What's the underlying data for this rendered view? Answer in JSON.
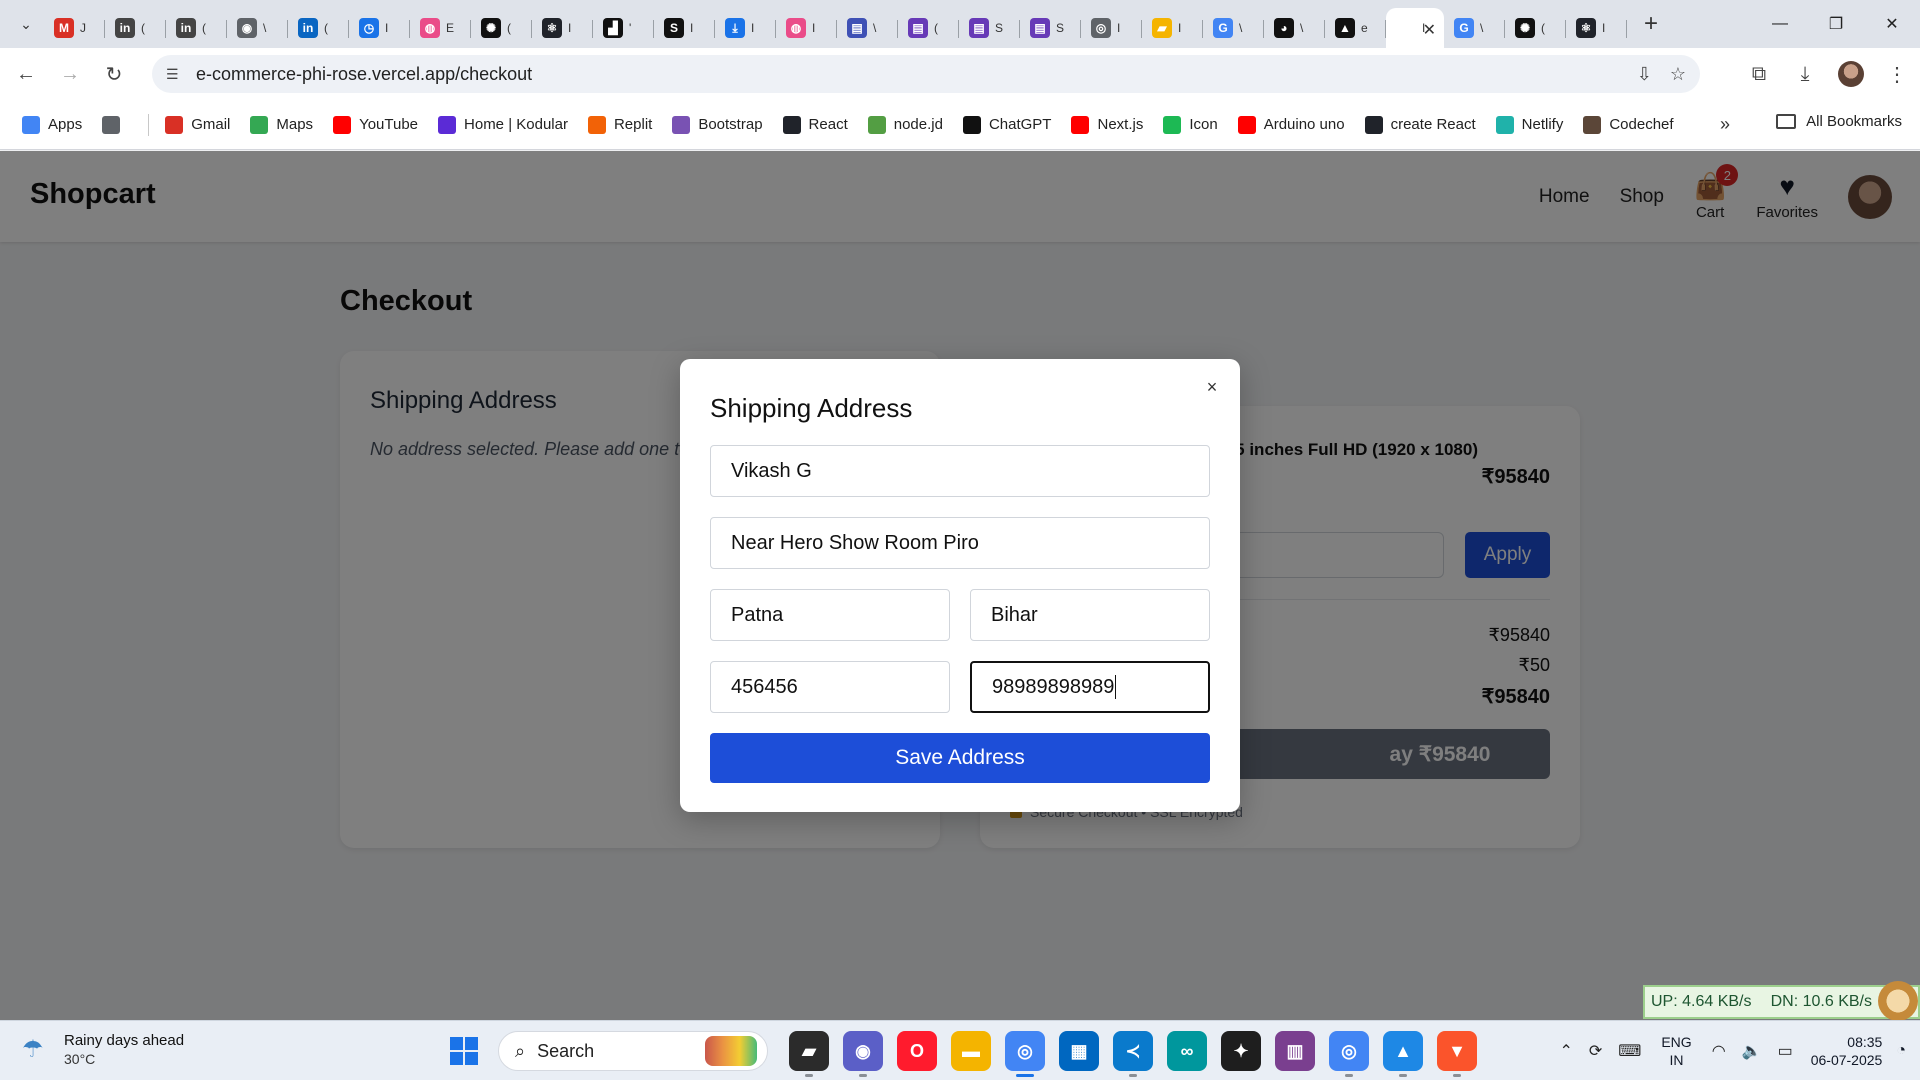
{
  "browser": {
    "tabs": [
      {
        "icon": "gmail-icon",
        "color": "#d93025",
        "glyph": "M",
        "title": "J"
      },
      {
        "icon": "indeed-icon",
        "color": "#444444",
        "glyph": "in",
        "title": "("
      },
      {
        "icon": "indeed-icon",
        "color": "#444444",
        "glyph": "in",
        "title": "("
      },
      {
        "icon": "globe-icon",
        "color": "#5f6368",
        "glyph": "◉",
        "title": "\\"
      },
      {
        "icon": "linkedin-icon",
        "color": "#0a66c2",
        "glyph": "in",
        "title": "("
      },
      {
        "icon": "history-icon",
        "color": "#1a73e8",
        "glyph": "◷",
        "title": "I"
      },
      {
        "icon": "dribbble-icon",
        "color": "#ea4c89",
        "glyph": "◍",
        "title": "E"
      },
      {
        "icon": "openai-icon",
        "color": "#111111",
        "glyph": "✺",
        "title": "("
      },
      {
        "icon": "react-icon",
        "color": "#20232a",
        "glyph": "⚛",
        "title": "I"
      },
      {
        "icon": "figure-icon",
        "color": "#111111",
        "glyph": "▟",
        "title": "'"
      },
      {
        "icon": "s-letter-icon",
        "color": "#111111",
        "glyph": "S",
        "title": "I"
      },
      {
        "icon": "download-icon",
        "color": "#1a73e8",
        "glyph": "⤓",
        "title": "I"
      },
      {
        "icon": "dribbble-icon",
        "color": "#ea4c89",
        "glyph": "◍",
        "title": "I"
      },
      {
        "icon": "forms-icon",
        "color": "#3f51b5",
        "glyph": "▤",
        "title": "\\"
      },
      {
        "icon": "forms-icon",
        "color": "#673ab7",
        "glyph": "▤",
        "title": "("
      },
      {
        "icon": "forms-icon",
        "color": "#673ab7",
        "glyph": "▤",
        "title": "S"
      },
      {
        "icon": "forms-icon",
        "color": "#673ab7",
        "glyph": "▤",
        "title": "S"
      },
      {
        "icon": "chrome-icon",
        "color": "#5f6368",
        "glyph": "◎",
        "title": "I"
      },
      {
        "icon": "courses-icon",
        "color": "#f5b400",
        "glyph": "▰",
        "title": "I"
      },
      {
        "icon": "google-icon",
        "color": "#4285f4",
        "glyph": "G",
        "title": "\\"
      },
      {
        "icon": "github-icon",
        "color": "#111111",
        "glyph": "◕",
        "title": "\\"
      },
      {
        "icon": "vercel-icon",
        "color": "#111111",
        "glyph": "▲",
        "title": "e"
      },
      {
        "icon": "page-icon",
        "color": "#ffffff",
        "glyph": "",
        "title": "I",
        "active": true
      },
      {
        "icon": "google-icon",
        "color": "#4285f4",
        "glyph": "G",
        "title": "\\"
      },
      {
        "icon": "openai-icon",
        "color": "#111111",
        "glyph": "✺",
        "title": "("
      },
      {
        "icon": "react-icon",
        "color": "#20232a",
        "glyph": "⚛",
        "title": "I"
      }
    ],
    "url": "e-commerce-phi-rose.vercel.app/checkout",
    "bookmarks": [
      {
        "label": "Apps",
        "icon": "apps-grid-icon",
        "color": "#4285f4"
      },
      {
        "label": "",
        "icon": "tab-groups-icon",
        "color": "#5f6368"
      },
      {
        "label": "Gmail",
        "icon": "gmail-icon",
        "color": "#d93025"
      },
      {
        "label": "Maps",
        "icon": "maps-icon",
        "color": "#34a853"
      },
      {
        "label": "YouTube",
        "icon": "youtube-icon",
        "color": "#ff0000"
      },
      {
        "label": "Home | Kodular",
        "icon": "kodular-icon",
        "color": "#5b2bd6"
      },
      {
        "label": "Replit",
        "icon": "replit-icon",
        "color": "#f26207"
      },
      {
        "label": "Bootstrap",
        "icon": "bootstrap-icon",
        "color": "#7952b3"
      },
      {
        "label": "React",
        "icon": "react-icon",
        "color": "#20232a"
      },
      {
        "label": "node.jd",
        "icon": "nodejs-icon",
        "color": "#539e43"
      },
      {
        "label": "ChatGPT",
        "icon": "openai-icon",
        "color": "#111111"
      },
      {
        "label": "Next.js",
        "icon": "youtube-icon",
        "color": "#ff0000"
      },
      {
        "label": "Icon",
        "icon": "icon-site-icon",
        "color": "#1db954"
      },
      {
        "label": "Arduino uno",
        "icon": "youtube-icon",
        "color": "#ff0000"
      },
      {
        "label": "create React",
        "icon": "react-icon",
        "color": "#20232a"
      },
      {
        "label": "Netlify",
        "icon": "netlify-icon",
        "color": "#20b2aa"
      },
      {
        "label": "Codechef",
        "icon": "codechef-icon",
        "color": "#5b4638"
      }
    ],
    "all_bookmarks": "All Bookmarks"
  },
  "site": {
    "logo": "Shopcart",
    "nav": {
      "home": "Home",
      "shop": "Shop",
      "cart": "Cart",
      "favorites": "Favorites",
      "cart_count": "2"
    },
    "page_title": "Checkout",
    "shipping_card": {
      "title": "Shipping Address",
      "empty_text": "No address selected. Please add one to pr"
    },
    "summary_card": {
      "product_name": ".5 inches Full HD (1920 x 1080)",
      "product_price": "₹95840",
      "apply_label": "Apply",
      "subtotal": "₹95840",
      "shipping": "₹50",
      "total": "₹95840",
      "pay_label": "ay ₹95840",
      "secure_text": "Secure Checkout • SSL Encrypted"
    },
    "modal": {
      "title": "Shipping Address",
      "close": "×",
      "name": "Vikash G",
      "address": "Near Hero Show Room Piro",
      "city": "Patna",
      "state": "Bihar",
      "pincode": "456456",
      "phone": "98989898989",
      "save_label": "Save Address"
    }
  },
  "netmeter": {
    "up": "UP: 4.64 KB/s",
    "down": "DN: 10.6 KB/s"
  },
  "taskbar": {
    "weather_title": "Rainy days ahead",
    "weather_temp": "30°C",
    "search_label": "Search",
    "apps": [
      {
        "icon": "file-manager-icon",
        "color": "#2b2b2b",
        "glyph": "▰"
      },
      {
        "icon": "meet-icon",
        "color": "#5b5fc7",
        "glyph": "◉"
      },
      {
        "icon": "opera-icon",
        "color": "#ff1b2d",
        "glyph": "O"
      },
      {
        "icon": "folder-icon",
        "color": "#f4b400",
        "glyph": "▬"
      },
      {
        "icon": "chrome-icon",
        "color": "#4285f4",
        "glyph": "◎",
        "active": true
      },
      {
        "icon": "store-icon",
        "color": "#0067c0",
        "glyph": "▦"
      },
      {
        "icon": "vscode-icon",
        "color": "#0a7acc",
        "glyph": "≺"
      },
      {
        "icon": "arduino-icon",
        "color": "#00979d",
        "glyph": "∞"
      },
      {
        "icon": "figma-icon",
        "color": "#1e1e1e",
        "glyph": "✦"
      },
      {
        "icon": "winrar-icon",
        "color": "#7a3f8f",
        "glyph": "▥"
      },
      {
        "icon": "chrome-icon",
        "color": "#4285f4",
        "glyph": "◎"
      },
      {
        "icon": "photos-icon",
        "color": "#1e88e5",
        "glyph": "▲"
      },
      {
        "icon": "brave-icon",
        "color": "#fb542b",
        "glyph": "▼"
      }
    ],
    "lang_top": "ENG",
    "lang_bottom": "IN",
    "time": "08:35",
    "date": "06-07-2025"
  }
}
